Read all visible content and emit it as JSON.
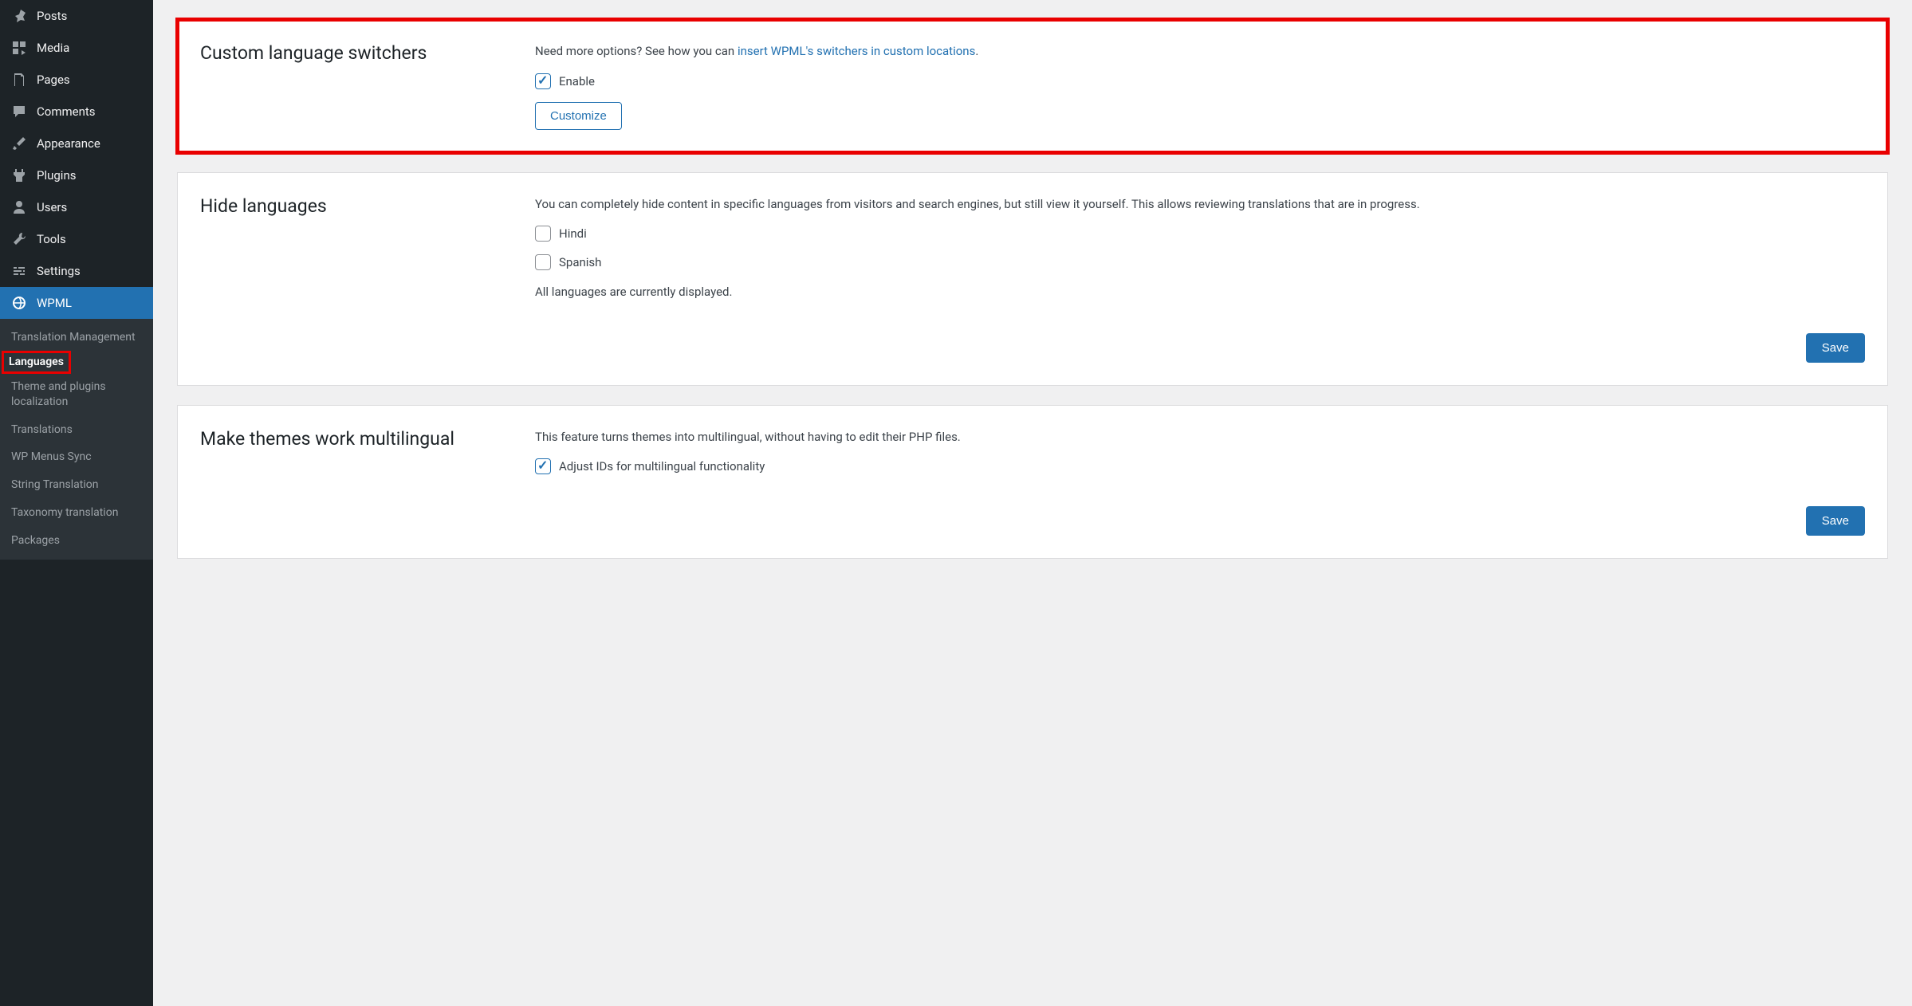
{
  "sidebar": {
    "items": [
      {
        "label": "Posts",
        "icon": "pin"
      },
      {
        "label": "Media",
        "icon": "media"
      },
      {
        "label": "Pages",
        "icon": "page"
      },
      {
        "label": "Comments",
        "icon": "comment"
      },
      {
        "label": "Appearance",
        "icon": "brush"
      },
      {
        "label": "Plugins",
        "icon": "plug"
      },
      {
        "label": "Users",
        "icon": "user"
      },
      {
        "label": "Tools",
        "icon": "wrench"
      },
      {
        "label": "Settings",
        "icon": "sliders"
      },
      {
        "label": "WPML",
        "icon": "wpml",
        "active": true
      }
    ],
    "submenu": [
      {
        "label": "Translation Management"
      },
      {
        "label": "Languages",
        "current": true
      },
      {
        "label": "Theme and plugins localization"
      },
      {
        "label": "Translations"
      },
      {
        "label": "WP Menus Sync"
      },
      {
        "label": "String Translation"
      },
      {
        "label": "Taxonomy translation"
      },
      {
        "label": "Packages"
      }
    ]
  },
  "sections": {
    "custom_switchers": {
      "title": "Custom language switchers",
      "desc_prefix": "Need more options? See how you can ",
      "link_text": "insert WPML's switchers in custom locations",
      "desc_suffix": ".",
      "enable_label": "Enable",
      "customize_label": "Customize"
    },
    "hide_languages": {
      "title": "Hide languages",
      "desc": "You can completely hide content in specific languages from visitors and search engines, but still view it yourself. This allows reviewing translations that are in progress.",
      "langs": [
        "Hindi",
        "Spanish"
      ],
      "status": "All languages are currently displayed.",
      "save_label": "Save"
    },
    "multilingual": {
      "title": "Make themes work multilingual",
      "desc": "This feature turns themes into multilingual, without having to edit their PHP files.",
      "checkbox_label": "Adjust IDs for multilingual functionality",
      "save_label": "Save"
    }
  }
}
